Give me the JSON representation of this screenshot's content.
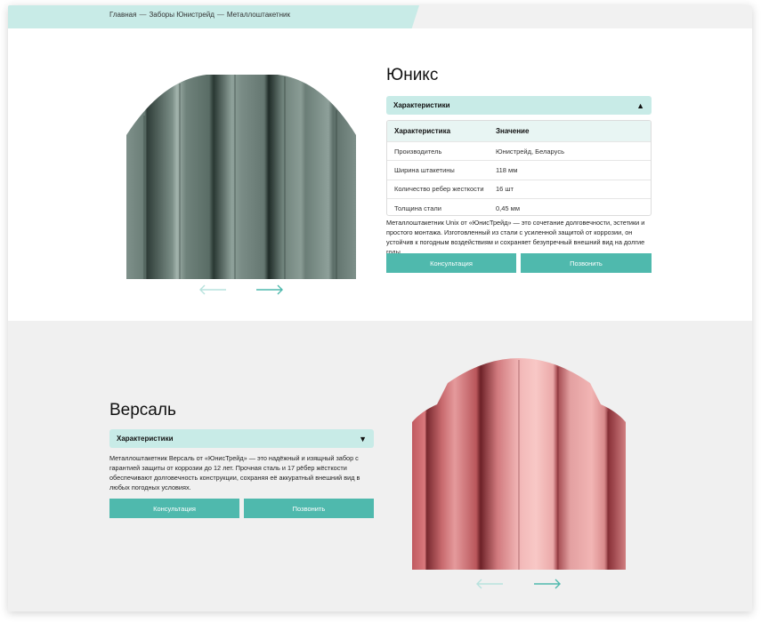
{
  "breadcrumb": {
    "items": [
      "Главная",
      "Заборы Юнистрейд",
      "Металлоштакетник"
    ],
    "separator": "—"
  },
  "products": [
    {
      "title": "Юникс",
      "accordion_label": "Характеристики",
      "accordion_state_icon": "▲",
      "table": {
        "headers": [
          "Характеристика",
          "Значение"
        ],
        "rows": [
          [
            "Производитель",
            "Юнистрейд, Беларусь"
          ],
          [
            "Ширина штакетины",
            "118 мм"
          ],
          [
            "Количество ребер жесткости",
            "16 шт"
          ],
          [
            "Толщина стали",
            "0,45 мм"
          ]
        ]
      },
      "description": "Металлоштакетник Unix от «ЮнисТрейд» — это сочетание долговечности, эстетики и простого монтажа. Изготовленный из стали с усиленной защитой от коррозии, он устойчив к погодным воздействиям и сохраняет безупречный внешний вид на долгие годы.",
      "button_consult": "Консультация",
      "button_call": "Позвонить",
      "color": "#6d8179"
    },
    {
      "title": "Версаль",
      "accordion_label": "Характеристики",
      "accordion_state_icon": "▼",
      "description": "Металлоштакетник Версаль от «ЮнисТрейд» — это надёжный и изящный забор с гарантией защиты от коррозии до 12 лет. Прочная сталь и 17 рёбер жёсткости обеспечивают долговечность конструкции, сохраняя её аккуратный внешний вид в любых погодных условиях.",
      "button_consult": "Консультация",
      "button_call": "Позвонить",
      "color": "#d46f73"
    }
  ],
  "colors": {
    "accent": "#4fb9ad",
    "accent_light": "#c8ebe7",
    "section_bg": "#f0f0f0"
  },
  "icons": {
    "prev": "arrow-left-icon",
    "next": "arrow-right-icon"
  }
}
